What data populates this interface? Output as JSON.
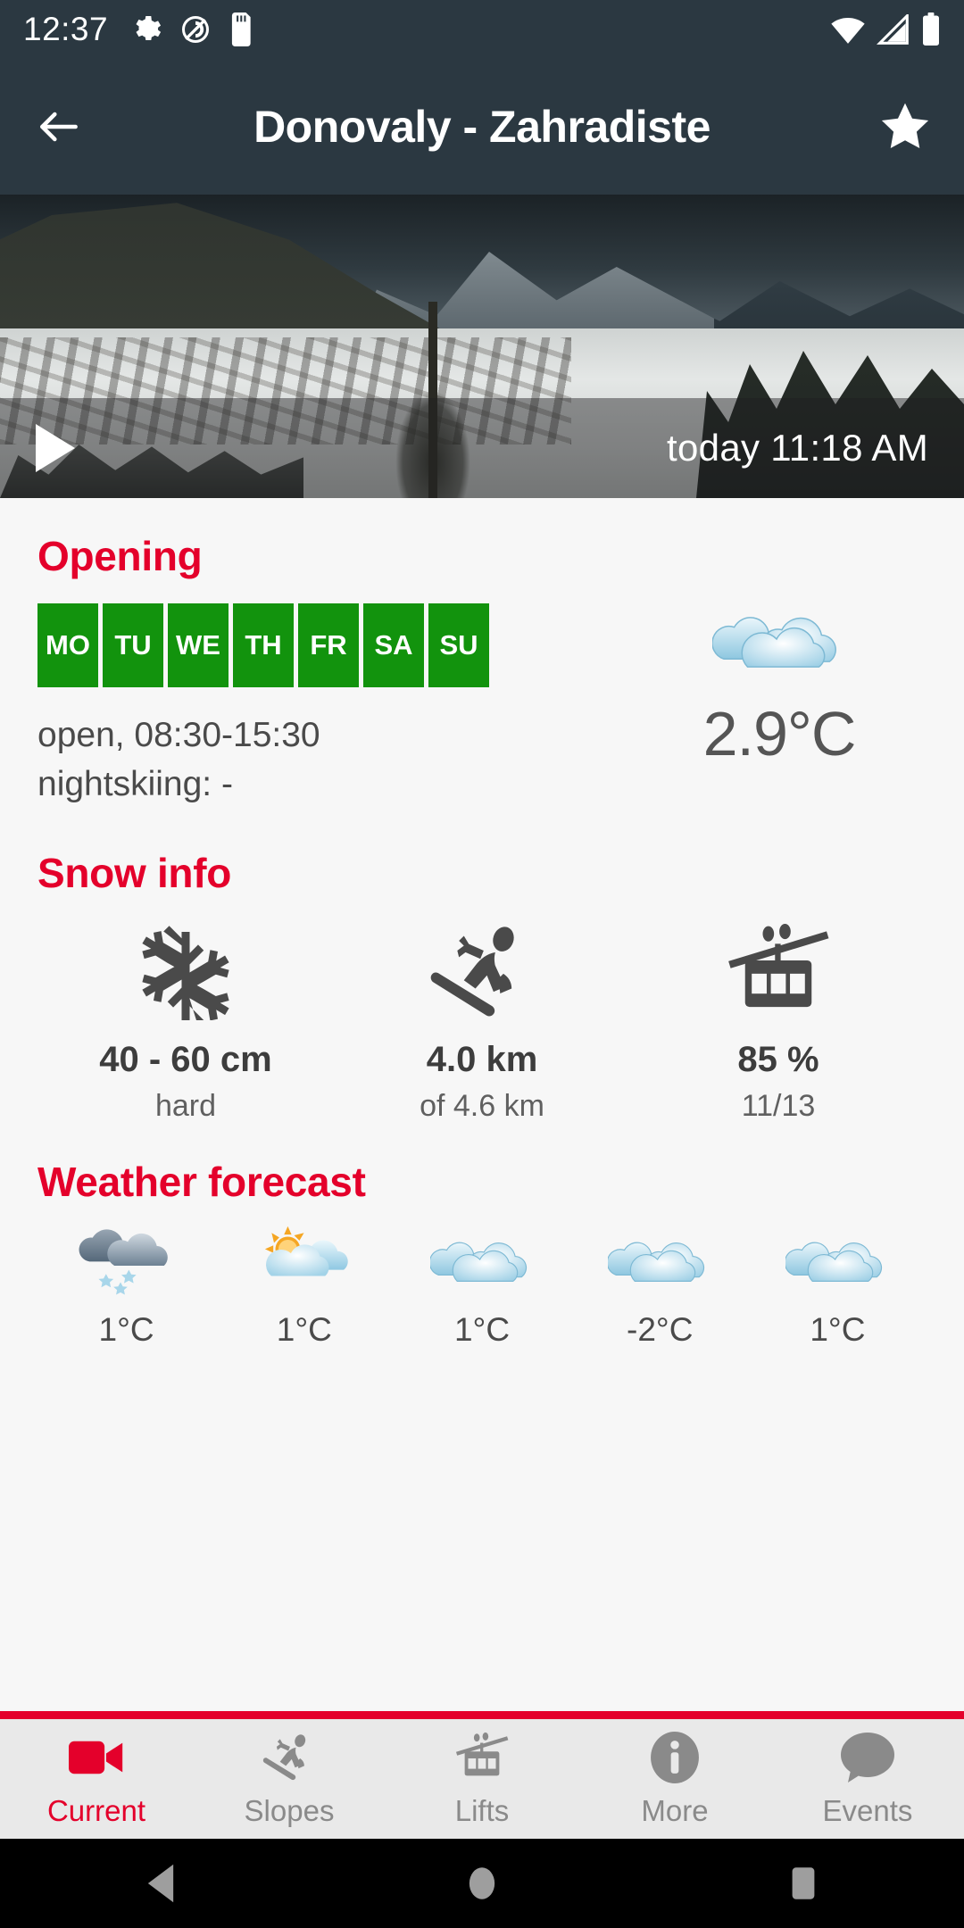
{
  "status_bar": {
    "time": "12:37",
    "icons_left": [
      "gear-icon",
      "location-disabled-icon",
      "sd-card-icon"
    ],
    "icons_right": [
      "wifi-icon",
      "signal-icon",
      "battery-icon"
    ]
  },
  "app_bar": {
    "back_icon": "back-arrow-icon",
    "title": "Donovaly - Zahradiste",
    "favorite_icon": "star-icon"
  },
  "webcam": {
    "play_icon": "play-icon",
    "timestamp": "today 11:18 AM"
  },
  "opening": {
    "title": "Opening",
    "days": [
      {
        "label": "MO",
        "open": true
      },
      {
        "label": "TU",
        "open": true
      },
      {
        "label": "WE",
        "open": true
      },
      {
        "label": "TH",
        "open": true
      },
      {
        "label": "FR",
        "open": true
      },
      {
        "label": "SA",
        "open": true
      },
      {
        "label": "SU",
        "open": true
      }
    ],
    "hours": "open, 08:30-15:30",
    "nightskiing": "nightskiing: -",
    "current_weather_icon": "cloudy-icon",
    "current_temperature": "2.9°C"
  },
  "snow_info": {
    "title": "Snow info",
    "items": [
      {
        "icon": "snowflake-icon",
        "value": "40 - 60 cm",
        "sub": "hard"
      },
      {
        "icon": "skier-icon",
        "value": "4.0 km",
        "sub": "of 4.6 km"
      },
      {
        "icon": "gondola-icon",
        "value": "85 %",
        "sub": "11/13"
      }
    ]
  },
  "weather_forecast": {
    "title": "Weather forecast",
    "days": [
      {
        "icon": "snow-shower-icon",
        "temp": "1°C"
      },
      {
        "icon": "sun-behind-cloud-icon",
        "temp": "1°C"
      },
      {
        "icon": "cloudy-icon",
        "temp": "1°C"
      },
      {
        "icon": "cloudy-icon",
        "temp": "-2°C"
      },
      {
        "icon": "cloudy-icon",
        "temp": "1°C"
      }
    ]
  },
  "bottom_nav": {
    "items": [
      {
        "label": "Current",
        "icon": "video-camera-icon",
        "active": true
      },
      {
        "label": "Slopes",
        "icon": "skier-icon",
        "active": false
      },
      {
        "label": "Lifts",
        "icon": "gondola-icon",
        "active": false
      },
      {
        "label": "More",
        "icon": "info-circle-icon",
        "active": false
      },
      {
        "label": "Events",
        "icon": "speech-bubble-icon",
        "active": false
      }
    ]
  },
  "android_nav": {
    "back_icon": "android-back-icon",
    "home_icon": "android-home-icon",
    "recents_icon": "android-recents-icon"
  },
  "colors": {
    "header": "#2b3841",
    "accent_red": "#e4002b",
    "open_green": "#12930d",
    "page_bg": "#f7f7f7",
    "nav_bg": "#e9e9e9"
  }
}
